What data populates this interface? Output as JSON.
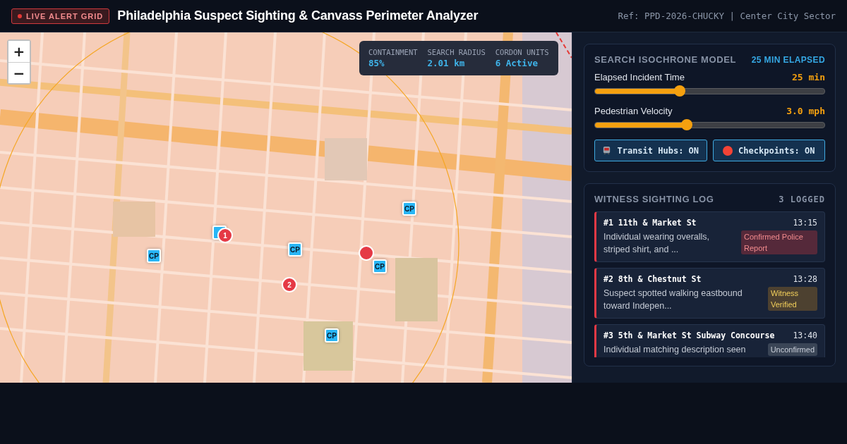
{
  "header": {
    "badge": "LIVE ALERT GRID",
    "title": "Philadelphia Suspect Sighting & Canvass Perimeter Analyzer",
    "reference": "Ref: PPD-2026-CHUCKY | Center City Sector"
  },
  "map": {
    "kind": "picture",
    "zoom_controls": [
      "+",
      "−"
    ],
    "stats": [
      {
        "label": "CONTAINMENT",
        "value": "85%"
      },
      {
        "label": "SEARCH RADIUS",
        "value": "2.01 km"
      },
      {
        "label": "CORDON UNITS",
        "value": "6 Active"
      }
    ],
    "markers": [
      {
        "kind": "checkpoint"
      },
      {
        "kind": "sighting",
        "label": "1"
      },
      {
        "kind": "checkpoint",
        "label": "CP"
      },
      {
        "kind": "checkpoint",
        "label": "CP"
      },
      {
        "kind": "sighting",
        "label": "2"
      },
      {
        "kind": "sighting"
      },
      {
        "kind": "checkpoint",
        "label": "CP"
      },
      {
        "kind": "checkpoint",
        "label": "CP"
      },
      {
        "kind": "checkpoint",
        "label": "CP"
      }
    ]
  },
  "isochrone": {
    "title": "SEARCH ISOCHRONE MODEL",
    "status": "25 MIN ELAPSED",
    "sliders": [
      {
        "label": "Elapsed Incident Time",
        "reading": "25 min",
        "level": 0.37
      },
      {
        "label": "Pedestrian Velocity",
        "reading": "3.0 mph",
        "level": 0.4
      }
    ],
    "toggles": [
      {
        "kind": "transit",
        "label": "Transit Hubs: ON",
        "on": true
      },
      {
        "kind": "checkpoint",
        "label": "Checkpoints: ON",
        "on": true
      }
    ]
  },
  "sighting_log": {
    "title": "WITNESS SIGHTING LOG",
    "count": "3 LOGGED",
    "entries": [
      {
        "title": "#1 11th & Market St",
        "time": "13:15",
        "text": "Individual wearing overalls, striped shirt, and ...",
        "status": "Confirmed Police Report",
        "kind": "confirmed"
      },
      {
        "title": "#2 8th & Chestnut St",
        "time": "13:28",
        "text": "Suspect spotted walking eastbound toward Indepen...",
        "status": "Witness Verified",
        "kind": "verified"
      },
      {
        "title": "#3 5th & Market St Subway Concourse",
        "time": "13:40",
        "text": "Individual matching description seen",
        "status": "Unconfirmed",
        "kind": "unconfirmed"
      }
    ]
  }
}
